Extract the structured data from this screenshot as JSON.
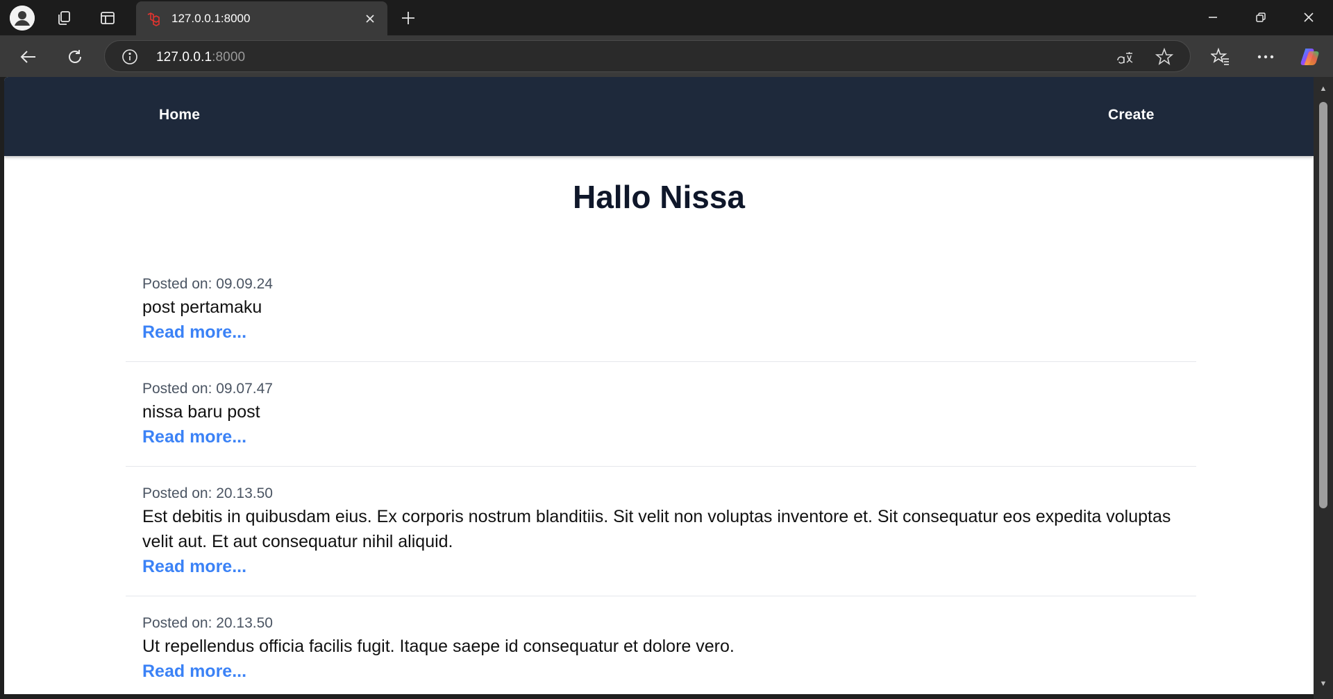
{
  "browser": {
    "tab": {
      "title": "127.0.0.1:8000"
    },
    "address": {
      "host": "127.0.0.1",
      "port": ":8000"
    }
  },
  "nav": {
    "home_label": "Home",
    "create_label": "Create"
  },
  "page": {
    "title": "Hallo Nissa"
  },
  "posts": [
    {
      "date": "Posted on: 09.09.24",
      "body": "post pertamaku",
      "link": "Read more..."
    },
    {
      "date": "Posted on: 09.07.47",
      "body": "nissa baru post",
      "link": "Read more..."
    },
    {
      "date": "Posted on: 20.13.50",
      "body": "Est debitis in quibusdam eius. Ex corporis nostrum blanditiis. Sit velit non voluptas inventore et. Sit consequatur eos expedita voluptas velit aut. Et aut consequatur nihil aliquid.",
      "link": "Read more..."
    },
    {
      "date": "Posted on: 20.13.50",
      "body": "Ut repellendus officia facilis fugit. Itaque saepe id consequatur et dolore vero.",
      "link": "Read more..."
    }
  ]
}
